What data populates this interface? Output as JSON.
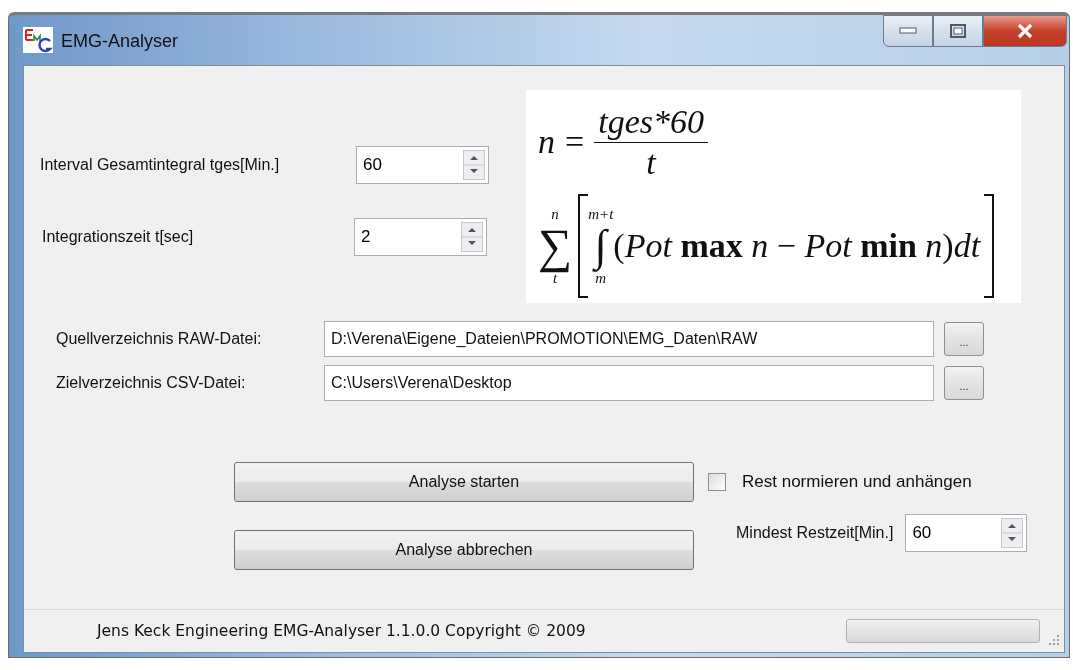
{
  "window": {
    "title": "EMG-Analyser"
  },
  "interval": {
    "label": "Interval Gesamtintegral  tges[Min.]",
    "value": "60"
  },
  "integration": {
    "label": "Integrationszeit t[sec]",
    "value": "2"
  },
  "formula": {
    "lhs": "n",
    "equals": "=",
    "numerator": "tges*60",
    "denominator": "t",
    "sum_sign": "∑",
    "sum_upper": "n",
    "sum_lower": "t",
    "integral_sign": "∫",
    "integral_upper": "m+t",
    "integral_lower": "m",
    "integrand": "(*Pot* **max** *n* − *Pot* **min** *n*)*dt*"
  },
  "source": {
    "label": "Quellverzeichnis RAW-Datei:",
    "value": "D:\\Verena\\Eigene_Dateien\\PROMOTION\\EMG_Daten\\RAW",
    "browse": "..."
  },
  "target": {
    "label": "Zielverzeichnis CSV-Datei:",
    "value": "C:\\Users\\Verena\\Desktop",
    "browse": "..."
  },
  "buttons": [
    "Analyse starten",
    "Analyse abbrechen"
  ],
  "rest_checkbox": {
    "label": "Rest normieren und anhängen",
    "checked": false
  },
  "min_rest": {
    "label": "Mindest Restzeit[Min.]",
    "value": "60"
  },
  "status_bar": {
    "text": "Jens Keck Engineering EMG-Analyser 1.1.0.0 Copyright ©  2009",
    "progress": {
      "level": 0
    }
  }
}
